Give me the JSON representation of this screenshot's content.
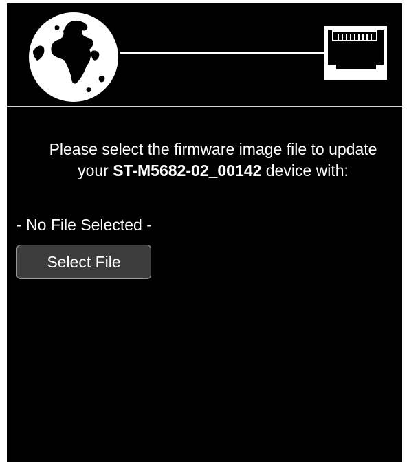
{
  "prompt": {
    "before_device": "Please select the firmware image file to update your ",
    "device_name": "ST-M5682-02_00142",
    "after_device": " device with:"
  },
  "file_status": "- No File Selected -",
  "select_button_label": "Select File",
  "icons": {
    "globe": "globe-icon",
    "ethernet": "ethernet-port-icon"
  },
  "colors": {
    "background": "#000000",
    "text": "#ffffff",
    "button_bg": "#3d3d3d",
    "button_border": "#9a9a9a"
  }
}
